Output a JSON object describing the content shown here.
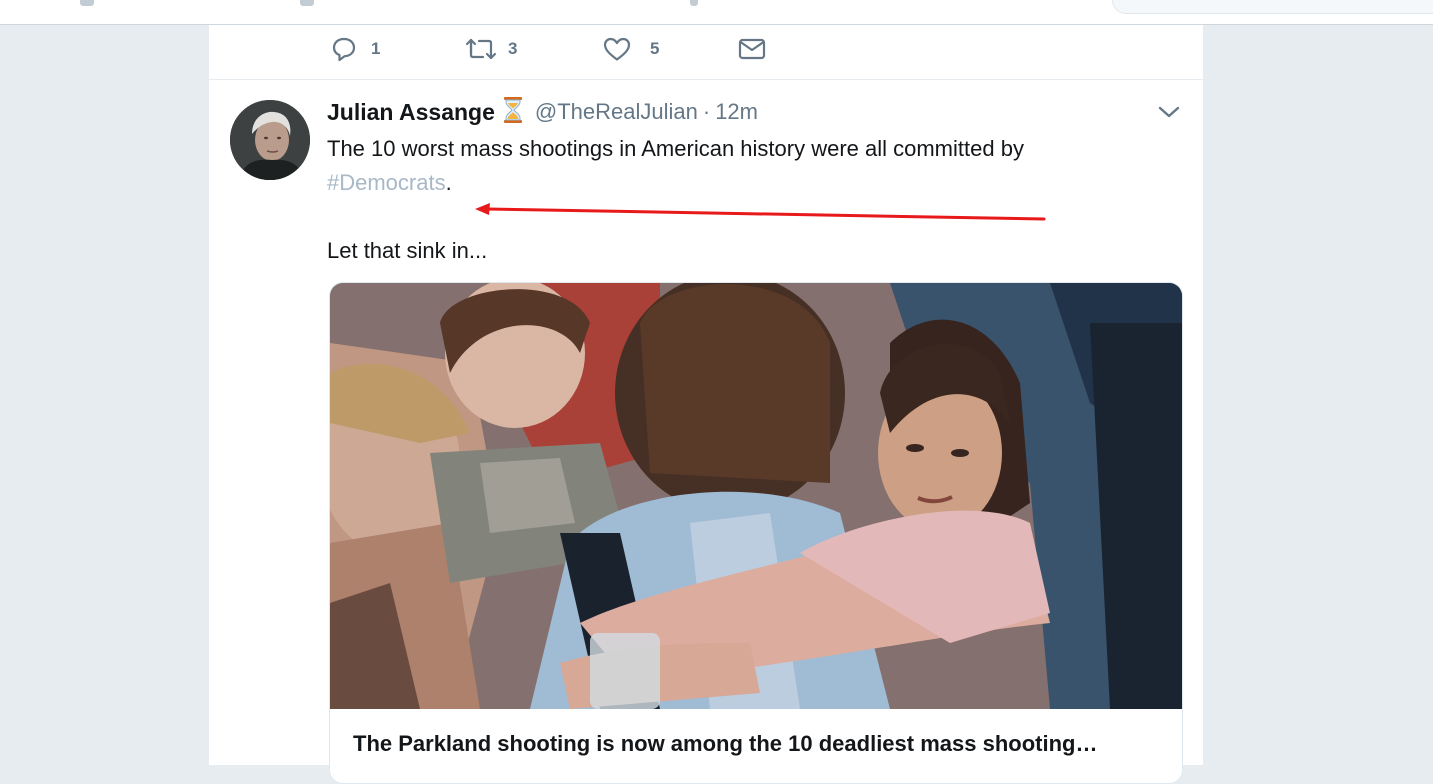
{
  "actions": {
    "reply_count": "1",
    "retweet_count": "3",
    "like_count": "5"
  },
  "tweet": {
    "author_name": "Julian Assange",
    "author_handle": "@TheRealJulian",
    "separator": "·",
    "time": "12m",
    "text_line1": "The 10 worst mass shootings in American history were all committed by",
    "hashtag": "#Democrats",
    "text_after_hashtag": ".",
    "text_line3": "Let that sink in...",
    "annotation_color": "#e8191b"
  },
  "card": {
    "title": "The Parkland shooting is now among the 10 deadliest mass shooting…"
  },
  "colors": {
    "icon_gray": "#657786",
    "hashtag": "#a8b8c7",
    "background": "#e6ecf0"
  },
  "icons": [
    "reply-icon",
    "retweet-icon",
    "like-icon",
    "direct-message-icon",
    "hourglass-icon",
    "chevron-down-icon"
  ]
}
